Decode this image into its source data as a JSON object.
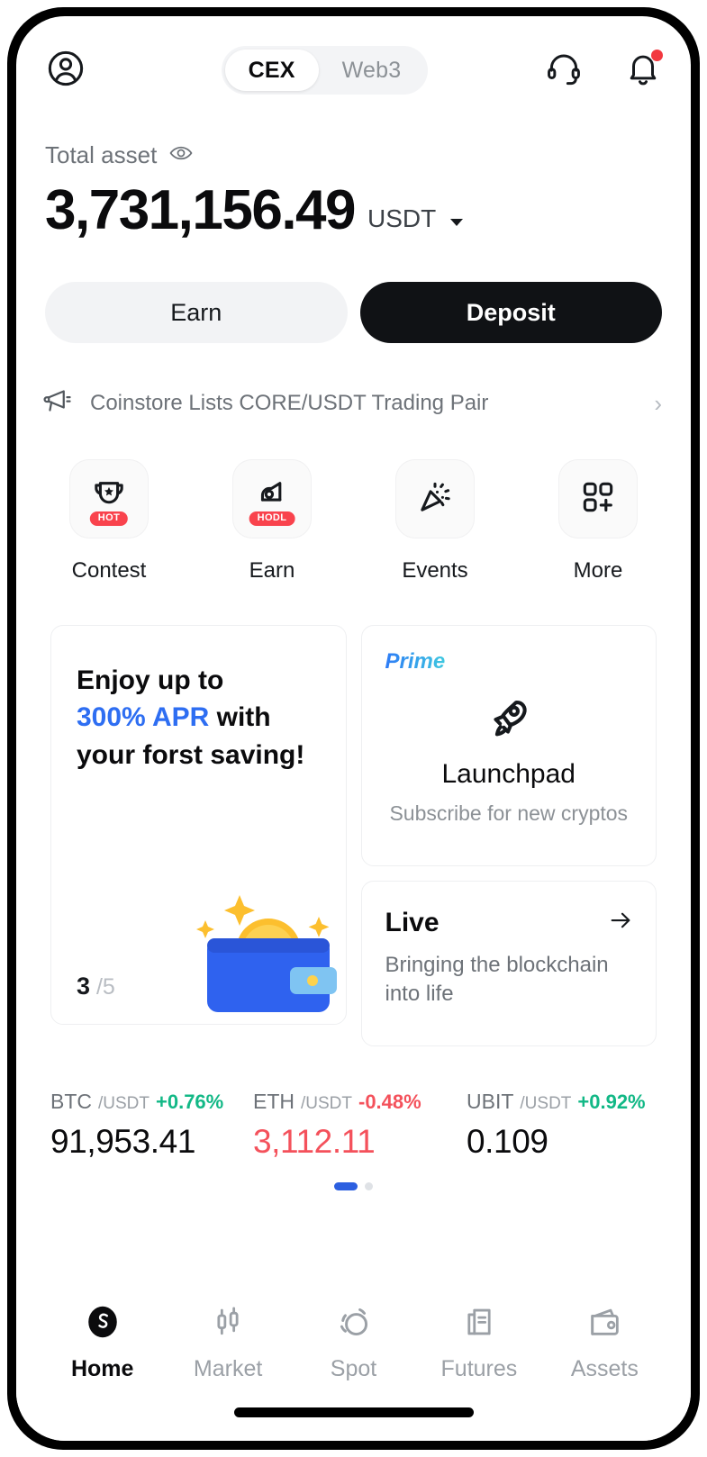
{
  "header": {
    "avatar_icon": "user-circle-icon",
    "tabs": [
      {
        "label": "CEX",
        "active": true
      },
      {
        "label": "Web3",
        "active": false
      }
    ],
    "support_icon": "headset-icon",
    "notification_icon": "bell-icon",
    "notification_has_badge": true
  },
  "balance": {
    "label": "Total asset",
    "visibility_icon": "eye-icon",
    "amount": "3,731,156.49",
    "currency": "USDT",
    "currency_caret_icon": "caret-down-icon"
  },
  "actions": {
    "earn_label": "Earn",
    "deposit_label": "Deposit"
  },
  "announcement": {
    "icon": "megaphone-icon",
    "text": "Coinstore Lists CORE/USDT Trading Pair",
    "chevron": "›"
  },
  "quick_actions": [
    {
      "label": "Contest",
      "icon": "trophy-icon",
      "badge": "HOT"
    },
    {
      "label": "Earn",
      "icon": "piggy-hand-icon",
      "badge": "HODL"
    },
    {
      "label": "Events",
      "icon": "confetti-icon",
      "badge": ""
    },
    {
      "label": "More",
      "icon": "grid-plus-icon",
      "badge": ""
    }
  ],
  "promo_card": {
    "line1": "Enjoy up to",
    "highlight": "300% APR",
    "line2_tail": " with",
    "line3": "your forst saving!",
    "page_current": "3",
    "page_total": "/5",
    "art_icon": "wallet-with-coin-illustration"
  },
  "launchpad_card": {
    "tag": "Prime",
    "icon": "rocket-icon",
    "title": "Launchpad",
    "subtitle": "Subscribe for new cryptos"
  },
  "live_card": {
    "title": "Live",
    "arrow_icon": "arrow-right-icon",
    "subtitle": "Bringing the blockchain into life"
  },
  "tickers": [
    {
      "base": "BTC",
      "quote": "/USDT",
      "change": "+0.76%",
      "direction": "up",
      "price": "91,953.41",
      "price_color": "neutral"
    },
    {
      "base": "ETH",
      "quote": "/USDT",
      "change": "-0.48%",
      "direction": "down",
      "price": "3,112.11",
      "price_color": "down"
    },
    {
      "base": "UBIT",
      "quote": "/USDT",
      "change": "+0.92%",
      "direction": "up",
      "price": "0.109",
      "price_color": "neutral"
    }
  ],
  "ticker_pager": {
    "total": 2,
    "active_index": 0
  },
  "bottom_nav": [
    {
      "label": "Home",
      "icon": "coinstore-logo-icon",
      "active": true
    },
    {
      "label": "Market",
      "icon": "candlestick-icon",
      "active": false
    },
    {
      "label": "Spot",
      "icon": "swap-circles-icon",
      "active": false
    },
    {
      "label": "Futures",
      "icon": "document-chart-icon",
      "active": false
    },
    {
      "label": "Assets",
      "icon": "wallet-icon",
      "active": false
    }
  ],
  "colors": {
    "accent_blue": "#2e6ef2",
    "up_green": "#12b886",
    "down_red": "#f4515b",
    "badge_red": "#f9434d",
    "primary_dark": "#101215"
  }
}
